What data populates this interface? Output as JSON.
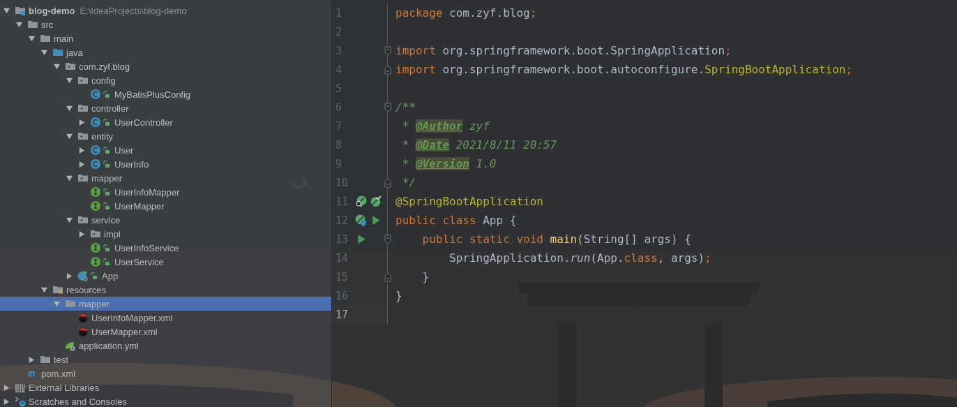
{
  "project_tree": [
    {
      "label": "blog-demo",
      "hint": "E:\\IdeaProjects\\blog-demo",
      "kind": "project",
      "expanded": true,
      "selected": false,
      "children": [
        {
          "label": "src",
          "kind": "folder",
          "expanded": true,
          "selected": false,
          "children": [
            {
              "label": "main",
              "kind": "folder",
              "expanded": true,
              "selected": false,
              "children": [
                {
                  "label": "java",
                  "kind": "source-root",
                  "expanded": true,
                  "selected": false,
                  "children": [
                    {
                      "label": "com.zyf.blog",
                      "kind": "package",
                      "expanded": true,
                      "selected": false,
                      "children": [
                        {
                          "label": "config",
                          "kind": "package",
                          "expanded": true,
                          "selected": false,
                          "children": [
                            {
                              "label": "MyBatisPlusConfig",
                              "kind": "class",
                              "public": true,
                              "selected": false
                            }
                          ]
                        },
                        {
                          "label": "controller",
                          "kind": "package",
                          "expanded": true,
                          "selected": false,
                          "children": [
                            {
                              "label": "UserController",
                              "kind": "class",
                              "public": true,
                              "expanded": false,
                              "selected": false
                            }
                          ]
                        },
                        {
                          "label": "entity",
                          "kind": "package",
                          "expanded": true,
                          "selected": false,
                          "children": [
                            {
                              "label": "User",
                              "kind": "class",
                              "public": true,
                              "expanded": false,
                              "selected": false
                            },
                            {
                              "label": "UserInfo",
                              "kind": "class",
                              "public": true,
                              "expanded": false,
                              "selected": false
                            }
                          ]
                        },
                        {
                          "label": "mapper",
                          "kind": "package",
                          "expanded": true,
                          "selected": false,
                          "children": [
                            {
                              "label": "UserInfoMapper",
                              "kind": "interface",
                              "public": true,
                              "selected": false
                            },
                            {
                              "label": "UserMapper",
                              "kind": "interface",
                              "public": true,
                              "selected": false
                            }
                          ]
                        },
                        {
                          "label": "service",
                          "kind": "package",
                          "expanded": true,
                          "selected": false,
                          "children": [
                            {
                              "label": "impl",
                              "kind": "package",
                              "expanded": false,
                              "selected": false
                            },
                            {
                              "label": "UserInfoService",
                              "kind": "interface",
                              "public": true,
                              "selected": false
                            },
                            {
                              "label": "UserService",
                              "kind": "interface",
                              "public": true,
                              "selected": false
                            }
                          ]
                        },
                        {
                          "label": "App",
                          "kind": "spring-class",
                          "public": true,
                          "expanded": false,
                          "selected": false
                        }
                      ]
                    }
                  ]
                },
                {
                  "label": "resources",
                  "kind": "resources-root",
                  "expanded": true,
                  "selected": false,
                  "children": [
                    {
                      "label": "mapper",
                      "kind": "folder",
                      "expanded": true,
                      "selected": true,
                      "children": [
                        {
                          "label": "UserInfoMapper.xml",
                          "kind": "mybatis-xml",
                          "selected": false
                        },
                        {
                          "label": "UserMapper.xml",
                          "kind": "mybatis-xml",
                          "selected": false
                        }
                      ]
                    },
                    {
                      "label": "application.yml",
                      "kind": "spring-yml",
                      "selected": false
                    }
                  ]
                }
              ]
            },
            {
              "label": "test",
              "kind": "folder",
              "expanded": false,
              "selected": false
            }
          ]
        },
        {
          "label": "pom.xml",
          "kind": "maven",
          "selected": false
        }
      ]
    },
    {
      "label": "External Libraries",
      "kind": "libraries",
      "expanded": false,
      "selected": false
    },
    {
      "label": "Scratches and Consoles",
      "kind": "scratches",
      "expanded": false,
      "selected": false
    }
  ],
  "editor": {
    "lines": [
      {
        "number": "1",
        "current": false,
        "tokens": [
          {
            "kind": "keyword",
            "text": "package "
          },
          {
            "kind": "plain",
            "text": "com.zyf.blog"
          },
          {
            "kind": "keyword",
            "text": ";"
          }
        ]
      },
      {
        "number": "2",
        "current": false
      },
      {
        "number": "3",
        "current": false,
        "fold_marker": {
          "kind": "start"
        },
        "tokens": [
          {
            "kind": "keyword",
            "text": "import "
          },
          {
            "kind": "plain",
            "text": "org.springframework.boot.SpringApplication"
          },
          {
            "kind": "keyword",
            "text": ";"
          }
        ]
      },
      {
        "number": "4",
        "current": false,
        "fold_marker": {
          "kind": "end"
        },
        "tokens": [
          {
            "kind": "keyword",
            "text": "import "
          },
          {
            "kind": "plain",
            "text": "org.springframework.boot.autoconfigure."
          },
          {
            "kind": "annotation",
            "text": "SpringBootApplication"
          },
          {
            "kind": "keyword",
            "text": ";"
          }
        ]
      },
      {
        "number": "5",
        "current": false
      },
      {
        "number": "6",
        "current": false,
        "fold_marker": {
          "kind": "start"
        },
        "tokens": [
          {
            "kind": "comment",
            "text": "/**"
          }
        ]
      },
      {
        "number": "7",
        "current": false,
        "tokens": [
          {
            "kind": "comment",
            "text": " * "
          },
          {
            "kind": "doc-tag",
            "text": "@Author"
          },
          {
            "kind": "comment",
            "text": " zyf"
          }
        ]
      },
      {
        "number": "8",
        "current": false,
        "tokens": [
          {
            "kind": "comment",
            "text": " * "
          },
          {
            "kind": "doc-tag",
            "text": "@Date"
          },
          {
            "kind": "comment",
            "text": " 2021/8/11 20:57"
          }
        ]
      },
      {
        "number": "9",
        "current": false,
        "tokens": [
          {
            "kind": "comment",
            "text": " * "
          },
          {
            "kind": "doc-tag",
            "text": "@Version"
          },
          {
            "kind": "comment",
            "text": " 1.0"
          }
        ]
      },
      {
        "number": "10",
        "current": false,
        "fold_marker": {
          "kind": "end"
        },
        "tokens": [
          {
            "kind": "comment",
            "text": " */"
          }
        ]
      },
      {
        "number": "11",
        "current": false,
        "gutter": [
          {
            "kind": "bean-search"
          },
          {
            "kind": "bean-check"
          }
        ],
        "tokens": [
          {
            "kind": "annotation",
            "text": "@SpringBootApplication"
          }
        ]
      },
      {
        "number": "12",
        "current": false,
        "gutter": [
          {
            "kind": "bean-class"
          },
          {
            "kind": "run"
          }
        ],
        "tokens": [
          {
            "kind": "keyword",
            "text": "public class "
          },
          {
            "kind": "plain",
            "text": "App {"
          }
        ]
      },
      {
        "number": "13",
        "current": false,
        "gutter": [
          {
            "kind": "run"
          }
        ],
        "fold_marker": {
          "kind": "start"
        },
        "tokens": [
          {
            "kind": "keyword",
            "text": "    public static void "
          },
          {
            "kind": "function",
            "text": "main"
          },
          {
            "kind": "plain",
            "text": "(String[] args) {"
          }
        ]
      },
      {
        "number": "14",
        "current": false,
        "tokens": [
          {
            "kind": "plain",
            "text": "        SpringApplication."
          },
          {
            "kind": "static-call",
            "text": "run"
          },
          {
            "kind": "plain",
            "text": "(App."
          },
          {
            "kind": "keyword",
            "text": "class"
          },
          {
            "kind": "plain",
            "text": ", args)"
          },
          {
            "kind": "keyword",
            "text": ";"
          }
        ]
      },
      {
        "number": "15",
        "current": false,
        "fold_marker": {
          "kind": "end"
        },
        "tokens": [
          {
            "kind": "plain",
            "text": "    }"
          }
        ]
      },
      {
        "number": "16",
        "current": false,
        "tokens": [
          {
            "kind": "plain",
            "text": "}"
          }
        ]
      },
      {
        "number": "17",
        "current": true
      }
    ]
  }
}
